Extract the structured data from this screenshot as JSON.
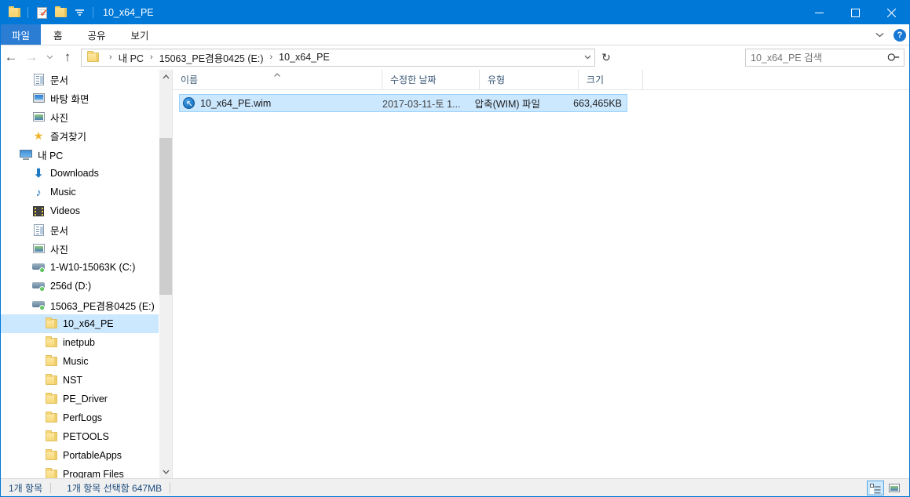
{
  "window": {
    "title": "10_x64_PE",
    "app_icon": "folder-icon",
    "quick_access": [
      {
        "name": "properties-icon",
        "label": "속성"
      },
      {
        "name": "new-folder-icon",
        "label": "새 폴더"
      },
      {
        "name": "customize-qat-chevron-icon",
        "label": "빠른 실행 도구 모음 사용자 지정"
      }
    ],
    "controls": {
      "minimize": "—",
      "maximize": "☐",
      "close": "✕"
    },
    "accent_color": "#0078d7"
  },
  "ribbon": {
    "tabs": [
      {
        "label": "파일",
        "active_style": "file"
      },
      {
        "label": "홈",
        "active_style": "normal"
      },
      {
        "label": "공유",
        "active_style": "normal"
      },
      {
        "label": "보기",
        "active_style": "normal"
      }
    ],
    "expand_icon": "chevron-down-icon",
    "help_icon": "help-question-icon",
    "help_label": "?"
  },
  "navigation": {
    "back": "←",
    "forward": "→",
    "recent": "⌄",
    "up": "↑",
    "refresh": "↻",
    "crumb_dropdown": "⌄"
  },
  "breadcrumb": {
    "icon": "folder-icon",
    "separator": "›",
    "items": [
      "내 PC",
      "15063_PE겸용0425 (E:)",
      "10_x64_PE"
    ]
  },
  "search": {
    "placeholder": "10_x64_PE 검색",
    "value": "",
    "icon": "search-icon"
  },
  "sidebar": {
    "items": [
      {
        "label": "문서",
        "icon": "documents-icon",
        "indent": "lvl1",
        "selected": false
      },
      {
        "label": "바탕 화면",
        "icon": "desktop-icon",
        "indent": "lvl1",
        "selected": false
      },
      {
        "label": "사진",
        "icon": "pictures-icon",
        "indent": "lvl1",
        "selected": false
      },
      {
        "label": "즐겨찾기",
        "icon": "favorites-star-icon",
        "indent": "lvl1",
        "selected": false
      },
      {
        "label": "내 PC",
        "icon": "this-pc-icon",
        "indent": "lvl0",
        "selected": false
      },
      {
        "label": "Downloads",
        "icon": "downloads-icon",
        "indent": "lvl1",
        "selected": false
      },
      {
        "label": "Music",
        "icon": "music-icon",
        "indent": "lvl1",
        "selected": false
      },
      {
        "label": "Videos",
        "icon": "videos-icon",
        "indent": "lvl1",
        "selected": false
      },
      {
        "label": "문서",
        "icon": "documents-icon",
        "indent": "lvl1",
        "selected": false
      },
      {
        "label": "사진",
        "icon": "pictures-icon",
        "indent": "lvl1",
        "selected": false
      },
      {
        "label": "1-W10-15063K (C:)",
        "icon": "drive-icon",
        "indent": "lvl1",
        "selected": false
      },
      {
        "label": "256d (D:)",
        "icon": "drive-icon",
        "indent": "lvl1",
        "selected": false
      },
      {
        "label": "15063_PE겸용0425 (E:)",
        "icon": "drive-icon",
        "indent": "lvl1",
        "selected": false
      },
      {
        "label": "10_x64_PE",
        "icon": "folder-icon",
        "indent": "lvl2",
        "selected": true
      },
      {
        "label": "inetpub",
        "icon": "folder-icon",
        "indent": "lvl2",
        "selected": false
      },
      {
        "label": "Music",
        "icon": "folder-icon",
        "indent": "lvl2",
        "selected": false
      },
      {
        "label": "NST",
        "icon": "folder-icon",
        "indent": "lvl2",
        "selected": false
      },
      {
        "label": "PE_Driver",
        "icon": "folder-icon",
        "indent": "lvl2",
        "selected": false
      },
      {
        "label": "PerfLogs",
        "icon": "folder-icon",
        "indent": "lvl2",
        "selected": false
      },
      {
        "label": "PETOOLS",
        "icon": "folder-icon",
        "indent": "lvl2",
        "selected": false
      },
      {
        "label": "PortableApps",
        "icon": "folder-icon",
        "indent": "lvl2",
        "selected": false
      },
      {
        "label": "Program Files",
        "icon": "folder-icon",
        "indent": "lvl2",
        "selected": false
      }
    ],
    "scrollbar": {
      "up_arrow": "⌃",
      "down_arrow": "⌄"
    }
  },
  "filelist": {
    "columns": [
      {
        "label": "이름",
        "sorted": true,
        "sort_caret": "⌃"
      },
      {
        "label": "수정한 날짜",
        "sorted": false,
        "sort_caret": ""
      },
      {
        "label": "유형",
        "sorted": false,
        "sort_caret": ""
      },
      {
        "label": "크기",
        "sorted": false,
        "sort_caret": ""
      }
    ],
    "rows": [
      {
        "icon": "wim-file-icon",
        "name": "10_x64_PE.wim",
        "date": "2017-03-11-토 1...",
        "type": "압축(WIM) 파일",
        "size": "663,465KB",
        "selected": true
      }
    ]
  },
  "statusbar": {
    "item_count": "1개 항목",
    "selection": "1개 항목 선택함 647MB",
    "views": [
      {
        "name": "details-view-button",
        "label": "자세히",
        "active": true
      },
      {
        "name": "large-icons-view-button",
        "label": "큰 아이콘",
        "active": false
      }
    ]
  }
}
